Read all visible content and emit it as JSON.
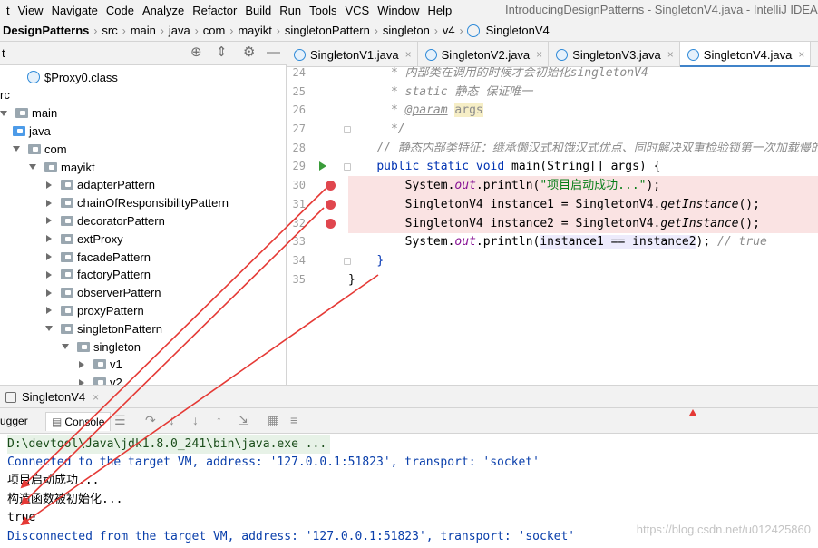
{
  "menu": {
    "items": [
      "t",
      "View",
      "Navigate",
      "Code",
      "Analyze",
      "Refactor",
      "Build",
      "Run",
      "Tools",
      "VCS",
      "Window",
      "Help"
    ],
    "window_title": "IntroducingDesignPatterns - SingletonV4.java - IntelliJ IDEA"
  },
  "breadcrumbs": [
    "DesignPatterns",
    "src",
    "main",
    "java",
    "com",
    "mayikt",
    "singletonPattern",
    "singleton",
    "v4",
    "SingletonV4"
  ],
  "project_panel": {
    "title": "t"
  },
  "tree": [
    {
      "label": "$Proxy0.class",
      "kind": "class",
      "indent": 30,
      "arrow": "none"
    },
    {
      "label": "rc",
      "kind": "text",
      "indent": 0,
      "arrow": "none"
    },
    {
      "label": "main",
      "kind": "folder",
      "indent": 0,
      "arrow": "down"
    },
    {
      "label": "java",
      "kind": "folder-blue",
      "indent": 0,
      "arrow": "none"
    },
    {
      "label": "com",
      "kind": "folder",
      "indent": 14,
      "arrow": "down"
    },
    {
      "label": "mayikt",
      "kind": "folder",
      "indent": 32,
      "arrow": "down"
    },
    {
      "label": "adapterPattern",
      "kind": "folder",
      "indent": 50,
      "arrow": "right"
    },
    {
      "label": "chainOfResponsibilityPattern",
      "kind": "folder",
      "indent": 50,
      "arrow": "right"
    },
    {
      "label": "decoratorPattern",
      "kind": "folder",
      "indent": 50,
      "arrow": "right"
    },
    {
      "label": "extProxy",
      "kind": "folder",
      "indent": 50,
      "arrow": "right"
    },
    {
      "label": "facadePattern",
      "kind": "folder",
      "indent": 50,
      "arrow": "right"
    },
    {
      "label": "factoryPattern",
      "kind": "folder",
      "indent": 50,
      "arrow": "right"
    },
    {
      "label": "observerPattern",
      "kind": "folder",
      "indent": 50,
      "arrow": "right"
    },
    {
      "label": "proxyPattern",
      "kind": "folder",
      "indent": 50,
      "arrow": "right"
    },
    {
      "label": "singletonPattern",
      "kind": "folder",
      "indent": 50,
      "arrow": "down"
    },
    {
      "label": "singleton",
      "kind": "folder",
      "indent": 68,
      "arrow": "down"
    },
    {
      "label": "v1",
      "kind": "folder",
      "indent": 86,
      "arrow": "right"
    },
    {
      "label": "v2",
      "kind": "folder",
      "indent": 86,
      "arrow": "right"
    }
  ],
  "editor_tabs": [
    {
      "label": "SingletonV1.java",
      "active": false
    },
    {
      "label": "SingletonV2.java",
      "active": false
    },
    {
      "label": "SingletonV3.java",
      "active": false
    },
    {
      "label": "SingletonV4.java",
      "active": true
    }
  ],
  "code": {
    "line_numbers": [
      "24",
      "25",
      "26",
      "27",
      "28",
      "29",
      "30",
      "31",
      "32",
      "33",
      "34",
      "35"
    ],
    "comment_24": "* 内部类在调用的时候才会初始化singletonV4",
    "comment_25": "* static 静态 保证唯一",
    "comment_26_a": "* ",
    "comment_26_tag": "@param",
    "comment_26_arg": "args",
    "comment_27": "*/",
    "comment_28": "// 静态内部类特征：继承懒汉式和饿汉式优点、同时解决双重检验锁第一次加载慢的",
    "line_29_kw": "public static void ",
    "line_29_rest": "main(String[] args) {",
    "line_30_a": "System.",
    "line_30_out": "out",
    "line_30_b": ".println(",
    "line_30_str": "\"项目启动成功...\"",
    "line_30_c": ");",
    "line_31_a": "SingletonV4 instance1 = SingletonV4.",
    "line_31_m": "getInstance",
    "line_31_b": "();",
    "line_32_a": "SingletonV4 instance2 = SingletonV4.",
    "line_32_m": "getInstance",
    "line_32_b": "();",
    "line_33_a": "System.",
    "line_33_out": "out",
    "line_33_b": ".println(",
    "line_33_hl": "instance1 == instance2",
    "line_33_c": "); ",
    "line_33_cm": "// true",
    "line_34": "}",
    "line_35": "}"
  },
  "run_panel": {
    "tab_label": "SingletonV4",
    "debugger_label": "ugger",
    "console_label": "Console"
  },
  "console": {
    "lines": [
      {
        "text": "D:\\devtool\\Java\\jdk1.8.0_241\\bin\\java.exe ...",
        "kind": "cmd"
      },
      {
        "text": "Connected to the target VM, address: '127.0.0.1:51823', transport: 'socket'",
        "kind": "sys"
      },
      {
        "text": "项目启动成功...",
        "kind": "out"
      },
      {
        "text": "构造函数被初始化...",
        "kind": "out"
      },
      {
        "text": "true",
        "kind": "out"
      },
      {
        "text": "Disconnected from the target VM, address: '127.0.0.1:51823', transport: 'socket'",
        "kind": "sys"
      }
    ],
    "watermark": "https://blog.csdn.net/u012425860"
  },
  "colors": {
    "breakpoint": "#e0464e",
    "annotation_arrow": "#e53935",
    "keyword": "#0033b3",
    "string": "#067d17",
    "comment": "#8c8c8c",
    "active_tab_underline": "#4083c9"
  }
}
